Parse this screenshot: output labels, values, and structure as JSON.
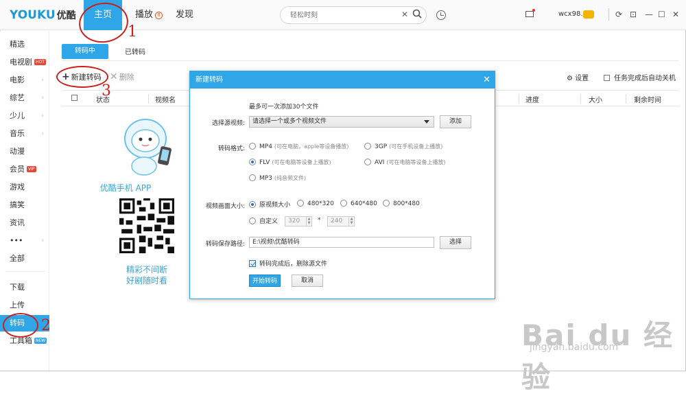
{
  "header": {
    "logo_en": "YOUKU",
    "logo_cn": "优酷",
    "nav": [
      {
        "label": "主页"
      },
      {
        "label": "播放"
      },
      {
        "label": "发现"
      }
    ],
    "search_placeholder": "轻松时刻",
    "username": "wcx98...",
    "icons": [
      "search-icon",
      "clock-icon",
      "mail-icon",
      "refresh-icon",
      "minimize-icon",
      "restore-icon",
      "close-icon"
    ]
  },
  "sidebar": {
    "items": [
      {
        "label": "精选"
      },
      {
        "label": "电视剧",
        "tag": "HOT"
      },
      {
        "label": "电影"
      },
      {
        "label": "综艺"
      },
      {
        "label": "少儿"
      },
      {
        "label": "音乐"
      },
      {
        "label": "动漫"
      },
      {
        "label": "会员",
        "tag": "VIP"
      },
      {
        "label": "游戏"
      },
      {
        "label": "搞笑"
      },
      {
        "label": "资讯"
      },
      {
        "label": "•••"
      },
      {
        "label": "全部"
      },
      {
        "label": "下载"
      },
      {
        "label": "上传"
      },
      {
        "label": "转码"
      },
      {
        "label": "工具箱",
        "tag": "NEW"
      }
    ]
  },
  "main": {
    "tabs": [
      {
        "label": "转码中"
      },
      {
        "label": "已转码"
      }
    ],
    "toolbar": {
      "new_label": "新建转码",
      "delete_label": "删除",
      "settings_label": "设置",
      "autoshutdown_label": "任务完成后自动关机"
    },
    "columns": [
      "状态",
      "视频名",
      "进度",
      "大小",
      "剩余时间"
    ],
    "promo": {
      "title": "优酷手机 APP",
      "line1": "精彩不间断",
      "line2": "好剧随时看"
    }
  },
  "dialog": {
    "title": "新建转码",
    "hint": "最多可一次添加30个文件",
    "source_label": "选择源视频:",
    "source_value": "请选择一个或多个视频文件",
    "add_label": "添加",
    "format_label": "转码格式:",
    "formats": [
      {
        "name": "MP4",
        "desc": "(可在电脑，apple等设备播放)"
      },
      {
        "name": "3GP",
        "desc": "(可在手机设备上播放)"
      },
      {
        "name": "FLV",
        "desc": "(可在电脑等设备上播放)",
        "selected": true
      },
      {
        "name": "AVI",
        "desc": "(可在电脑等设备上播放)"
      },
      {
        "name": "MP3",
        "desc": "(纯音频文件)"
      }
    ],
    "size_label": "视频画面大小:",
    "sizes": [
      "原视频大小",
      "480*320",
      "640*480",
      "800*480"
    ],
    "custom_label": "自定义",
    "custom_w": "320",
    "custom_h": "240",
    "times": "*",
    "path_label": "转码保存路径:",
    "path_value": "E:\\视频\\优酷转码",
    "browse_label": "选择",
    "delete_source_label": "转码完成后，删除源文件",
    "start_label": "开始转码",
    "cancel_label": "取消"
  },
  "annotations": [
    "1",
    "2",
    "3"
  ],
  "watermark": {
    "main": "Bai du 经验",
    "sub": "jingyan.baidu.com"
  },
  "colors": {
    "accent": "#2fa6e7",
    "annotation": "#c8221f"
  }
}
